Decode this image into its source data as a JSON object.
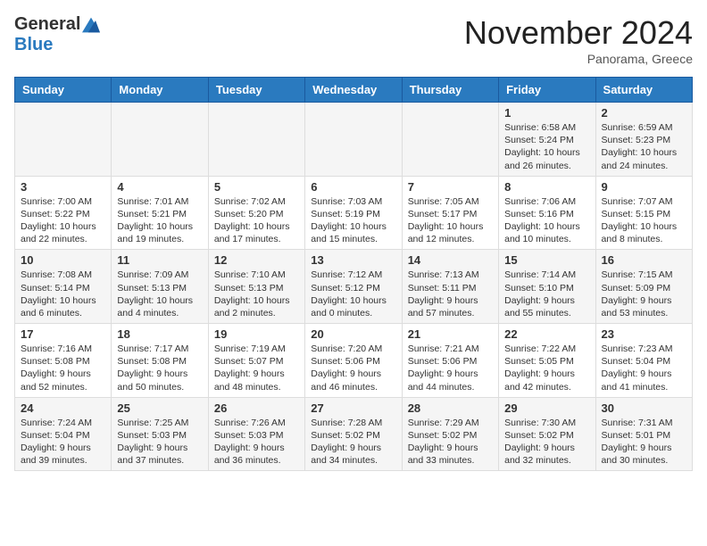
{
  "header": {
    "logo_general": "General",
    "logo_blue": "Blue",
    "month_title": "November 2024",
    "location": "Panorama, Greece"
  },
  "days_of_week": [
    "Sunday",
    "Monday",
    "Tuesday",
    "Wednesday",
    "Thursday",
    "Friday",
    "Saturday"
  ],
  "weeks": [
    [
      {
        "day": "",
        "info": ""
      },
      {
        "day": "",
        "info": ""
      },
      {
        "day": "",
        "info": ""
      },
      {
        "day": "",
        "info": ""
      },
      {
        "day": "",
        "info": ""
      },
      {
        "day": "1",
        "info": "Sunrise: 6:58 AM\nSunset: 5:24 PM\nDaylight: 10 hours and 26 minutes."
      },
      {
        "day": "2",
        "info": "Sunrise: 6:59 AM\nSunset: 5:23 PM\nDaylight: 10 hours and 24 minutes."
      }
    ],
    [
      {
        "day": "3",
        "info": "Sunrise: 7:00 AM\nSunset: 5:22 PM\nDaylight: 10 hours and 22 minutes."
      },
      {
        "day": "4",
        "info": "Sunrise: 7:01 AM\nSunset: 5:21 PM\nDaylight: 10 hours and 19 minutes."
      },
      {
        "day": "5",
        "info": "Sunrise: 7:02 AM\nSunset: 5:20 PM\nDaylight: 10 hours and 17 minutes."
      },
      {
        "day": "6",
        "info": "Sunrise: 7:03 AM\nSunset: 5:19 PM\nDaylight: 10 hours and 15 minutes."
      },
      {
        "day": "7",
        "info": "Sunrise: 7:05 AM\nSunset: 5:17 PM\nDaylight: 10 hours and 12 minutes."
      },
      {
        "day": "8",
        "info": "Sunrise: 7:06 AM\nSunset: 5:16 PM\nDaylight: 10 hours and 10 minutes."
      },
      {
        "day": "9",
        "info": "Sunrise: 7:07 AM\nSunset: 5:15 PM\nDaylight: 10 hours and 8 minutes."
      }
    ],
    [
      {
        "day": "10",
        "info": "Sunrise: 7:08 AM\nSunset: 5:14 PM\nDaylight: 10 hours and 6 minutes."
      },
      {
        "day": "11",
        "info": "Sunrise: 7:09 AM\nSunset: 5:13 PM\nDaylight: 10 hours and 4 minutes."
      },
      {
        "day": "12",
        "info": "Sunrise: 7:10 AM\nSunset: 5:13 PM\nDaylight: 10 hours and 2 minutes."
      },
      {
        "day": "13",
        "info": "Sunrise: 7:12 AM\nSunset: 5:12 PM\nDaylight: 10 hours and 0 minutes."
      },
      {
        "day": "14",
        "info": "Sunrise: 7:13 AM\nSunset: 5:11 PM\nDaylight: 9 hours and 57 minutes."
      },
      {
        "day": "15",
        "info": "Sunrise: 7:14 AM\nSunset: 5:10 PM\nDaylight: 9 hours and 55 minutes."
      },
      {
        "day": "16",
        "info": "Sunrise: 7:15 AM\nSunset: 5:09 PM\nDaylight: 9 hours and 53 minutes."
      }
    ],
    [
      {
        "day": "17",
        "info": "Sunrise: 7:16 AM\nSunset: 5:08 PM\nDaylight: 9 hours and 52 minutes."
      },
      {
        "day": "18",
        "info": "Sunrise: 7:17 AM\nSunset: 5:08 PM\nDaylight: 9 hours and 50 minutes."
      },
      {
        "day": "19",
        "info": "Sunrise: 7:19 AM\nSunset: 5:07 PM\nDaylight: 9 hours and 48 minutes."
      },
      {
        "day": "20",
        "info": "Sunrise: 7:20 AM\nSunset: 5:06 PM\nDaylight: 9 hours and 46 minutes."
      },
      {
        "day": "21",
        "info": "Sunrise: 7:21 AM\nSunset: 5:06 PM\nDaylight: 9 hours and 44 minutes."
      },
      {
        "day": "22",
        "info": "Sunrise: 7:22 AM\nSunset: 5:05 PM\nDaylight: 9 hours and 42 minutes."
      },
      {
        "day": "23",
        "info": "Sunrise: 7:23 AM\nSunset: 5:04 PM\nDaylight: 9 hours and 41 minutes."
      }
    ],
    [
      {
        "day": "24",
        "info": "Sunrise: 7:24 AM\nSunset: 5:04 PM\nDaylight: 9 hours and 39 minutes."
      },
      {
        "day": "25",
        "info": "Sunrise: 7:25 AM\nSunset: 5:03 PM\nDaylight: 9 hours and 37 minutes."
      },
      {
        "day": "26",
        "info": "Sunrise: 7:26 AM\nSunset: 5:03 PM\nDaylight: 9 hours and 36 minutes."
      },
      {
        "day": "27",
        "info": "Sunrise: 7:28 AM\nSunset: 5:02 PM\nDaylight: 9 hours and 34 minutes."
      },
      {
        "day": "28",
        "info": "Sunrise: 7:29 AM\nSunset: 5:02 PM\nDaylight: 9 hours and 33 minutes."
      },
      {
        "day": "29",
        "info": "Sunrise: 7:30 AM\nSunset: 5:02 PM\nDaylight: 9 hours and 32 minutes."
      },
      {
        "day": "30",
        "info": "Sunrise: 7:31 AM\nSunset: 5:01 PM\nDaylight: 9 hours and 30 minutes."
      }
    ]
  ]
}
